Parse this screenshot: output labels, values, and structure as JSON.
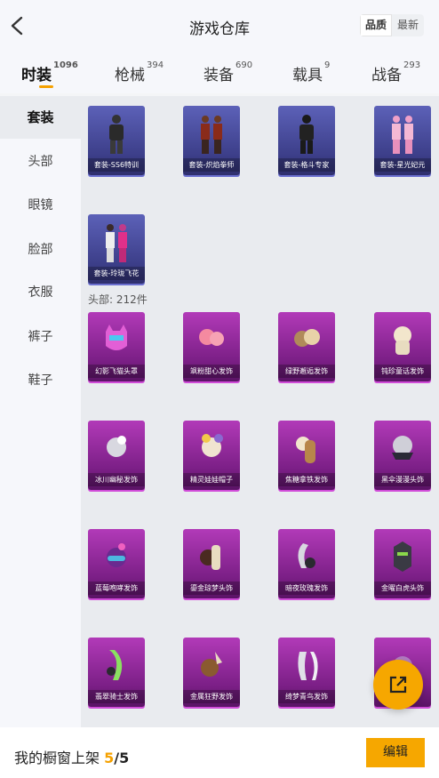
{
  "header": {
    "title": "游戏仓库",
    "sort_quality": "品质",
    "sort_latest": "最新"
  },
  "tabs": [
    {
      "label": "时装",
      "count": "1096"
    },
    {
      "label": "枪械",
      "count": "394"
    },
    {
      "label": "装备",
      "count": "690"
    },
    {
      "label": "载具",
      "count": "9"
    },
    {
      "label": "战备",
      "count": "293"
    }
  ],
  "sidebar": {
    "items": [
      "套装",
      "头部",
      "眼镜",
      "脸部",
      "衣服",
      "裤子",
      "鞋子"
    ]
  },
  "outfits": [
    {
      "name": "套装-SS6特训"
    },
    {
      "name": "套装-炽焰拳师"
    },
    {
      "name": "套装-格斗专家"
    },
    {
      "name": "套装-星光妃元"
    },
    {
      "name": "套装-玲珑飞花"
    }
  ],
  "head_section": {
    "label": "头部: 212件",
    "items": [
      {
        "name": "幻影飞猫头罩"
      },
      {
        "name": "飒粉甜心发饰"
      },
      {
        "name": "绿野邂逅发饰"
      },
      {
        "name": "钝珍童话发饰"
      },
      {
        "name": "冰川幽秘发饰"
      },
      {
        "name": "精灵娃娃帽子"
      },
      {
        "name": "焦糖拿铁发饰"
      },
      {
        "name": "黑伞漫漫头饰"
      },
      {
        "name": "蓝莓咆哮发饰"
      },
      {
        "name": "鎏金琼梦头饰"
      },
      {
        "name": "暗夜玫瑰发饰"
      },
      {
        "name": "金曜白虎头饰"
      },
      {
        "name": "翡翠骑士发饰"
      },
      {
        "name": "金属狂野发饰"
      },
      {
        "name": "绮梦青鸟发饰"
      }
    ]
  },
  "footer": {
    "label": "我的橱窗上架",
    "current": "5",
    "total": "/5",
    "edit_label": "编辑"
  },
  "colors": {
    "accent": "#f6a700",
    "outfit_card": "#3d3f8a",
    "head_card": "#7b1f86"
  }
}
